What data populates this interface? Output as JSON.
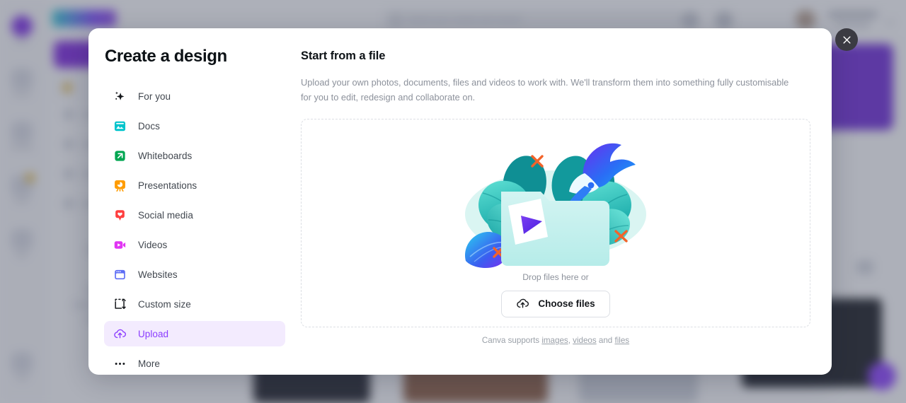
{
  "background": {
    "logo_alt": "canva-logo",
    "search_placeholder": "Search your content and Canva's",
    "user_name": "Nexus",
    "rail_items": [
      {
        "label": "Home",
        "icon": "home-icon",
        "active": true
      },
      {
        "label": "Projects",
        "icon": "projects-icon",
        "active": false
      },
      {
        "label": "Templates",
        "icon": "templates-icon",
        "active": false
      },
      {
        "label": "Brand",
        "icon": "brand-icon",
        "active": false
      },
      {
        "label": "Apps",
        "icon": "apps-icon",
        "active": false
      },
      {
        "label": "Trash",
        "icon": "trash-icon",
        "active": false
      }
    ]
  },
  "close_button": {
    "label": "Close",
    "icon": "close-icon"
  },
  "modal": {
    "title": "Create a design",
    "menu": [
      {
        "label": "For you",
        "icon": "sparkle-icon",
        "color": "#15181c",
        "active": false
      },
      {
        "label": "Docs",
        "icon": "docs-icon",
        "color": "#00c4cc",
        "active": false
      },
      {
        "label": "Whiteboards",
        "icon": "whiteboard-icon",
        "color": "#00a651",
        "active": false
      },
      {
        "label": "Presentations",
        "icon": "presentation-icon",
        "color": "#ff9c00",
        "active": false
      },
      {
        "label": "Social media",
        "icon": "heart-pin-icon",
        "color": "#ff3f3f",
        "active": false
      },
      {
        "label": "Videos",
        "icon": "video-icon",
        "color": "#e135f3",
        "active": false
      },
      {
        "label": "Websites",
        "icon": "website-icon",
        "color": "#5e6ef5",
        "active": false
      },
      {
        "label": "Custom size",
        "icon": "custom-size-icon",
        "color": "#15181c",
        "active": false
      },
      {
        "label": "Upload",
        "icon": "upload-cloud-icon",
        "color": "#8b3dff",
        "active": true
      },
      {
        "label": "More",
        "icon": "more-dots-icon",
        "color": "#15181c",
        "active": false
      }
    ],
    "panel": {
      "heading": "Start from a file",
      "description": "Upload your own photos, documents, files and videos to work with. We'll transform them into something fully customisable for you to edit, redesign and collaborate on.",
      "illustration": "folder-with-leaves-bird-illustration",
      "drop_text": "Drop files here or",
      "choose_button": {
        "label": "Choose files",
        "icon": "upload-cloud-icon"
      },
      "footer": {
        "prefix": "Canva supports ",
        "link_images": "images",
        "sep1": ", ",
        "link_videos": "videos",
        "sep2": " and ",
        "link_files": "files"
      }
    }
  },
  "colors": {
    "accent_purple": "#8b3dff",
    "accent_purple_soft": "#f3ebfe",
    "text_dark": "#0d1216",
    "text_muted": "#8c919b",
    "scrim": "#495063"
  }
}
